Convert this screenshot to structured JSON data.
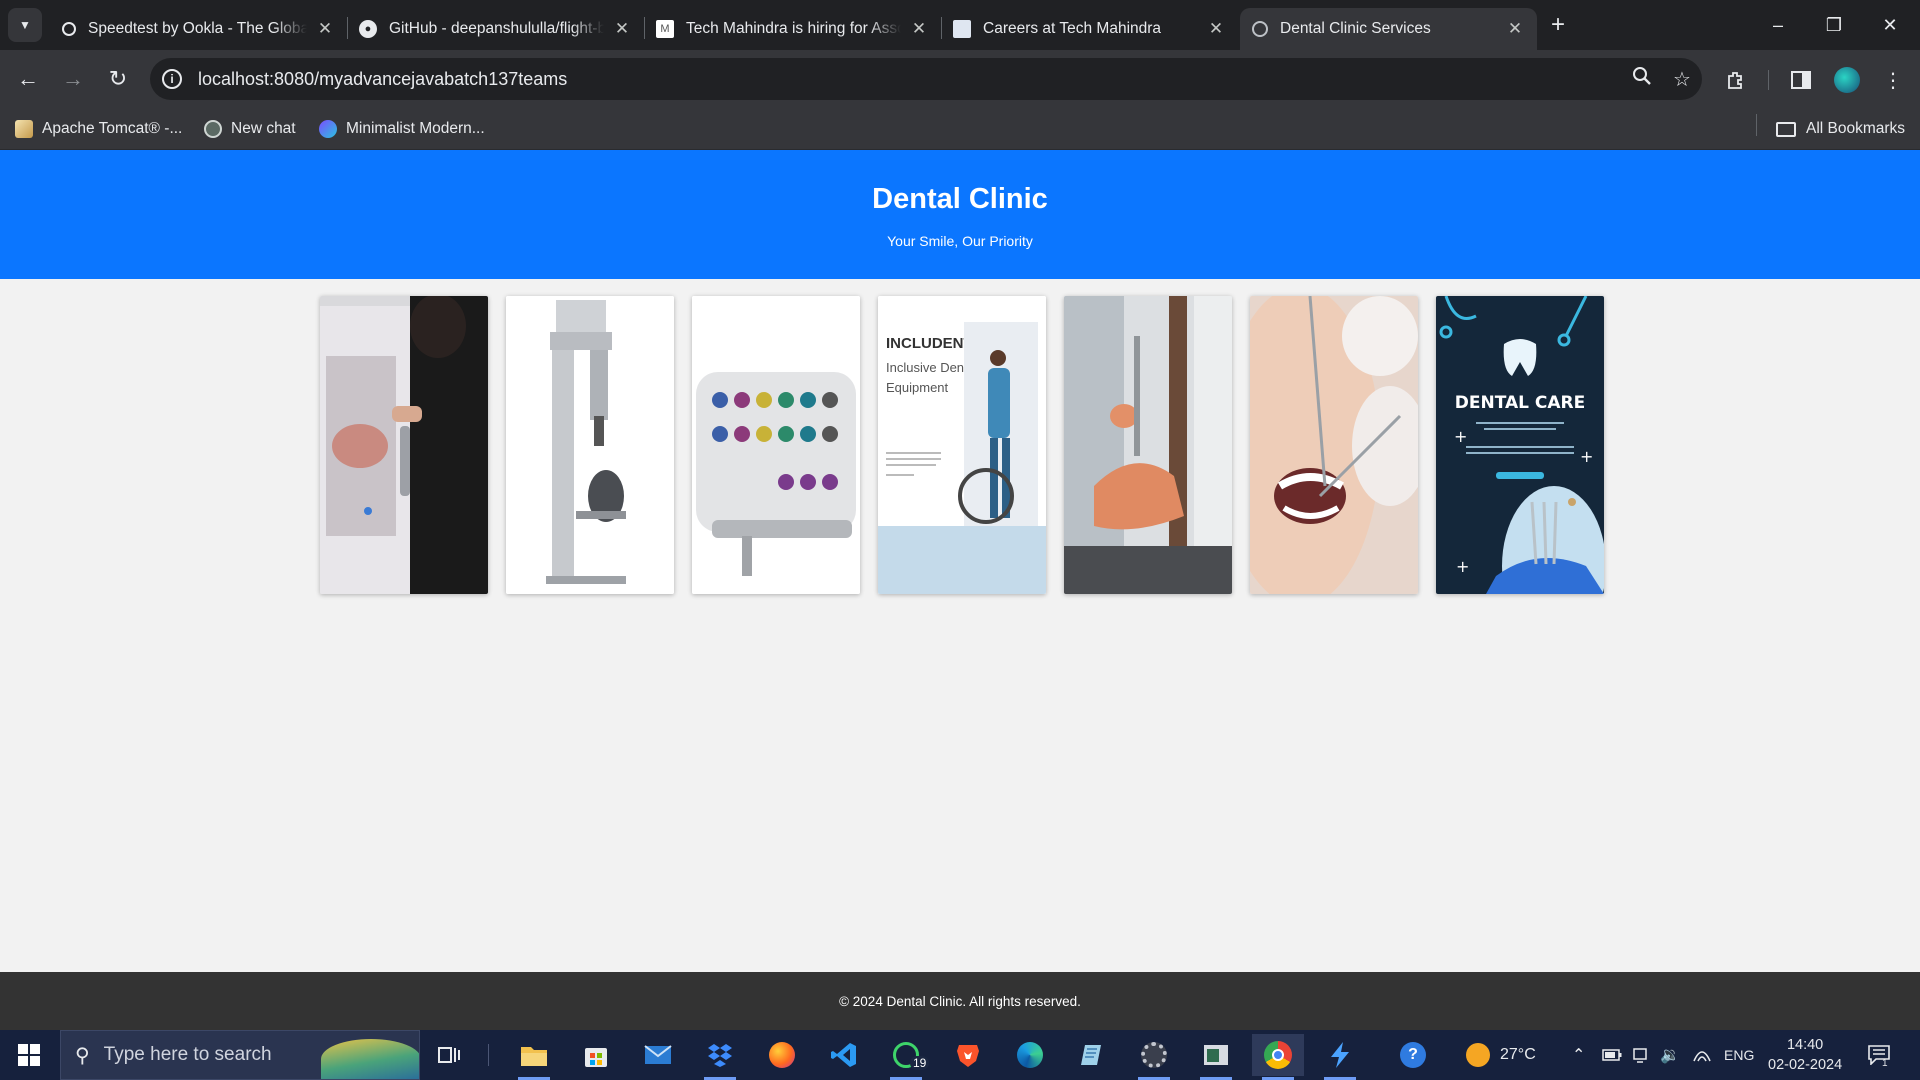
{
  "browser": {
    "tabs": [
      {
        "title": "Speedtest by Ookla - The Global Broadband Speed Test",
        "icon": "speedtest-icon",
        "active": false
      },
      {
        "title": "GitHub - deepanshululla/flight-booking",
        "icon": "github-icon",
        "active": false
      },
      {
        "title": "Tech Mahindra is hiring for Associate",
        "icon": "gmail-icon",
        "active": false
      },
      {
        "title": "Careers at Tech Mahindra",
        "icon": "document-icon",
        "active": false
      },
      {
        "title": "Dental Clinic Services",
        "icon": "globe-icon",
        "active": true
      }
    ],
    "url": "localhost:8080/myadvancejavabatch137teams",
    "bookmarks": [
      {
        "label": "Apache Tomcat® -...",
        "icon": "tomcat-icon"
      },
      {
        "label": "New chat",
        "icon": "chatgpt-icon"
      },
      {
        "label": "Minimalist Modern...",
        "icon": "canva-icon"
      }
    ],
    "all_bookmarks_label": "All Bookmarks"
  },
  "page": {
    "title": "Dental Clinic",
    "tagline": "Your Smile, Our Priority",
    "gallery": [
      {
        "image": "dentist-scanner-photo"
      },
      {
        "image": "xray-machine-photo"
      },
      {
        "image": "implant-kit-photo"
      },
      {
        "image": "inclusive-equipment-flyer",
        "text": [
          "INCLUDENT|",
          "Inclusive Dentistry",
          "Equipment"
        ]
      },
      {
        "image": "dental-chair-photo"
      },
      {
        "image": "dental-checkup-photo"
      },
      {
        "image": "dental-care-poster",
        "text": [
          "DENTAL CARE"
        ]
      }
    ],
    "footer": "© 2024 Dental Clinic. All rights reserved."
  },
  "taskbar": {
    "search_placeholder": "Type here to search",
    "apps": [
      "task-view-icon",
      "file-explorer-icon",
      "microsoft-store-icon",
      "mail-icon",
      "dropbox-icon",
      "firefox-icon",
      "vscode-icon",
      "whatsapp-icon",
      "brave-icon",
      "edge-icon",
      "notes-icon",
      "settings-icon",
      "app-window-icon",
      "chrome-icon",
      "bolt-icon"
    ],
    "whatsapp_badge": "19",
    "weather": "27°C",
    "language": "ENG",
    "time": "14:40",
    "date": "02-02-2024",
    "notification_count": "1"
  },
  "colors": {
    "header_bg": "#0b76ff",
    "footer_bg": "#333333",
    "page_bg": "#f2f2f2"
  }
}
